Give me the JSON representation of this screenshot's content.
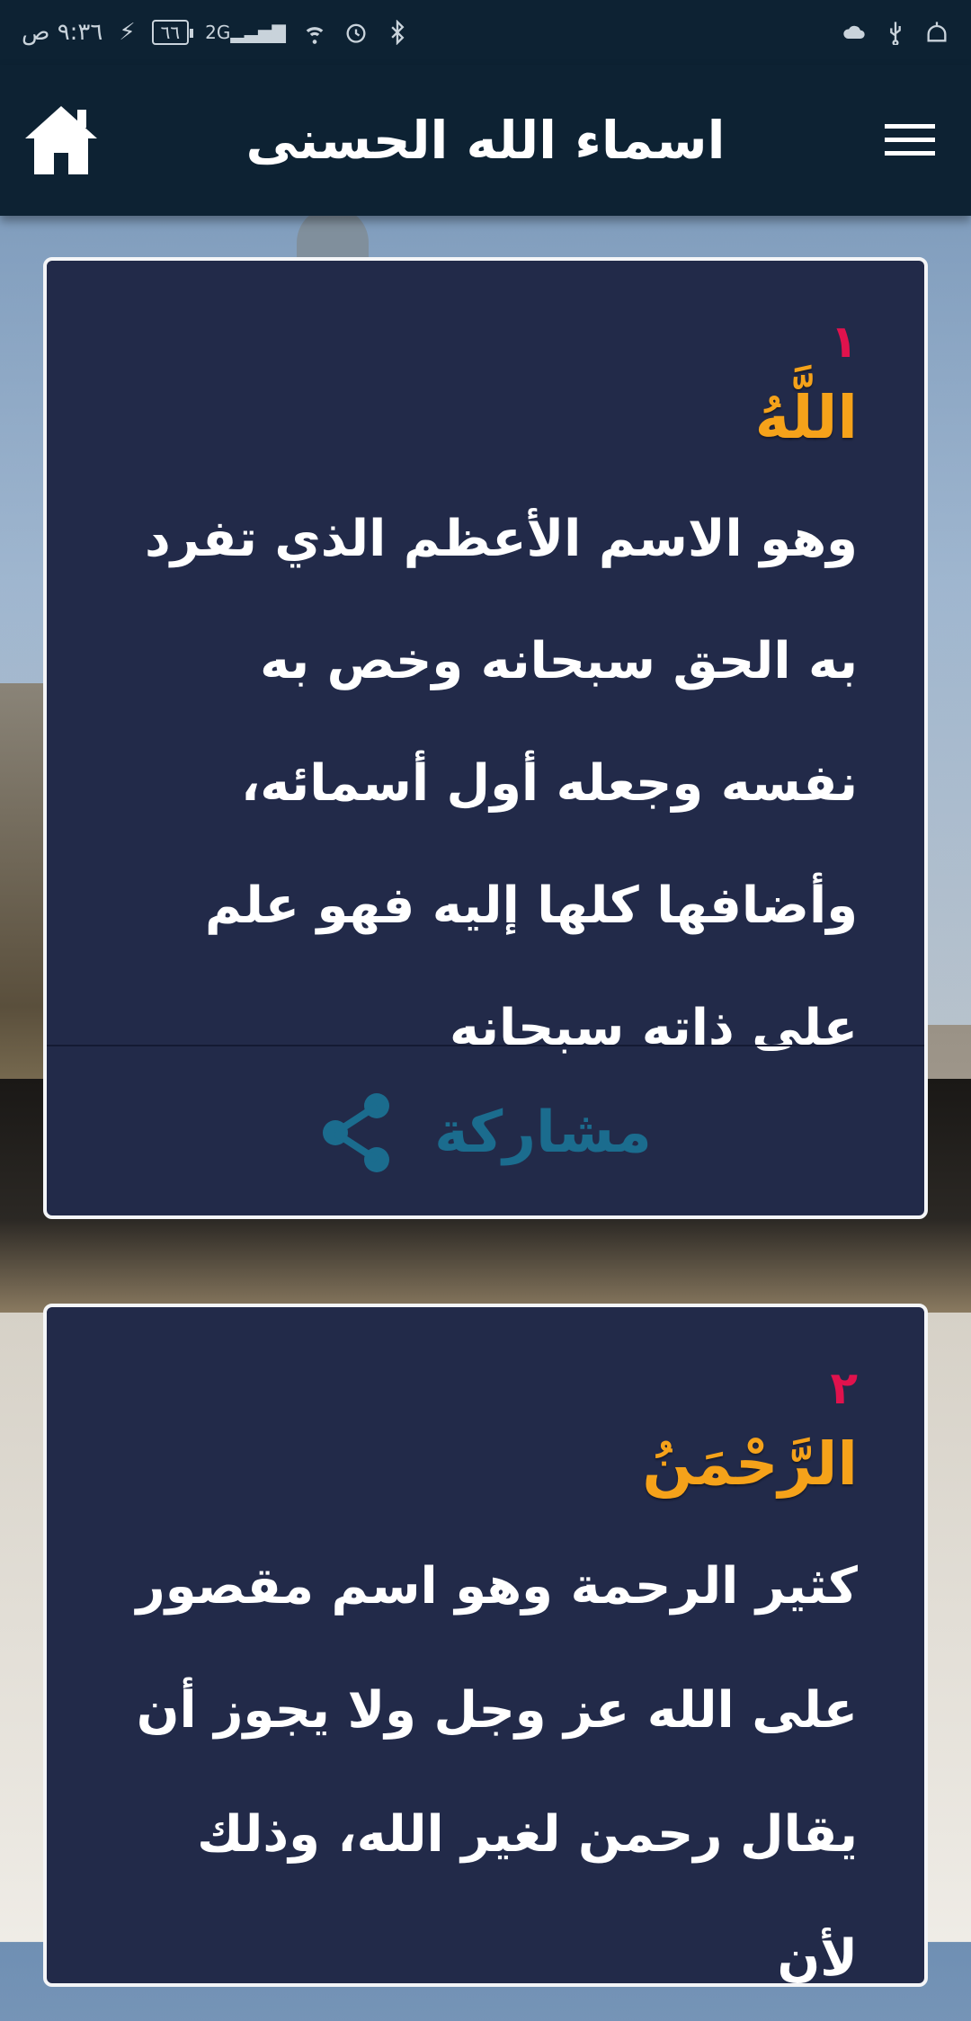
{
  "status_bar": {
    "time": "٩:٣٦ ص",
    "battery": "٦٦",
    "network": "2G"
  },
  "app_bar": {
    "title": "اسماء الله الحسنى",
    "home_icon": "home-icon",
    "menu_icon": "hamburger-menu-icon"
  },
  "cards": [
    {
      "number": "١",
      "name": "اللَّهُ",
      "description": "وهو الاسم الأعظم الذي تفرد به الحق سبحانه وخص به نفسه وجعله أول أسمائه، وأضافها كلها إليه فهو علم على ذاته سبحانه",
      "share_label": "مشاركة",
      "share_icon": "share-icon"
    },
    {
      "number": "٢",
      "name": "الرَّحْمَنُ",
      "description": "كثير الرحمة وهو اسم مقصور على الله عز وجل ولا يجوز أن يقال رحمن لغير الله، وذلك لأن"
    }
  ],
  "colors": {
    "app_bar": "#0d2233",
    "card_bg": "#222a49",
    "number": "#e0124d",
    "name": "#f5a21a",
    "share": "#1b6c8e"
  }
}
